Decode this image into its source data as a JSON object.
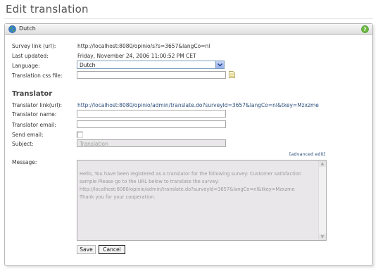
{
  "page": {
    "title": "Edit translation"
  },
  "panel": {
    "title": "Dutch",
    "icon": "globe-icon",
    "help_icon": "help-icon"
  },
  "fields": {
    "survey_link_label": "Survey link (url):",
    "survey_link_value": "http://localhost:8080/opinio/s?s=3657&langCo=nl",
    "last_updated_label": "Last updated:",
    "last_updated_value": "Friday, November 24, 2006 11:00:52 PM CET",
    "language_label": "Language:",
    "language_value": "Dutch",
    "css_label": "Translation css file:",
    "css_value": ""
  },
  "translator": {
    "heading": "Translator",
    "link_label": "Translator link(url):",
    "link_value": "http://localhost:8080/opinio/admin/translate.do?surveyId=3657&langCo=nl&tkey=Mzxzme",
    "name_label": "Translator name:",
    "name_value": "",
    "email_label": "Translator email:",
    "email_value": "",
    "send_email_label": "Send email:",
    "send_email_checked": false,
    "subject_label": "Subject:",
    "subject_value": "Translation",
    "advanced_edit": "[advanced edit]",
    "message_label": "Message:",
    "message_value": "Hello, You have been registered as a translator for the following survey: Customer satisfaction sample Please go to the URL below to translate the survey:\nhttp://localhost:8080/opinio/admin/translate.do?surveyId=3657&langCo=nl&tkey=Mzxzme\nThank you for your cooperation."
  },
  "buttons": {
    "save": "Save",
    "cancel": "Cancel"
  },
  "colors": {
    "link": "#2b4f7a",
    "disabled_bg": "#e9e7e9",
    "header_bg": "#dedede"
  }
}
